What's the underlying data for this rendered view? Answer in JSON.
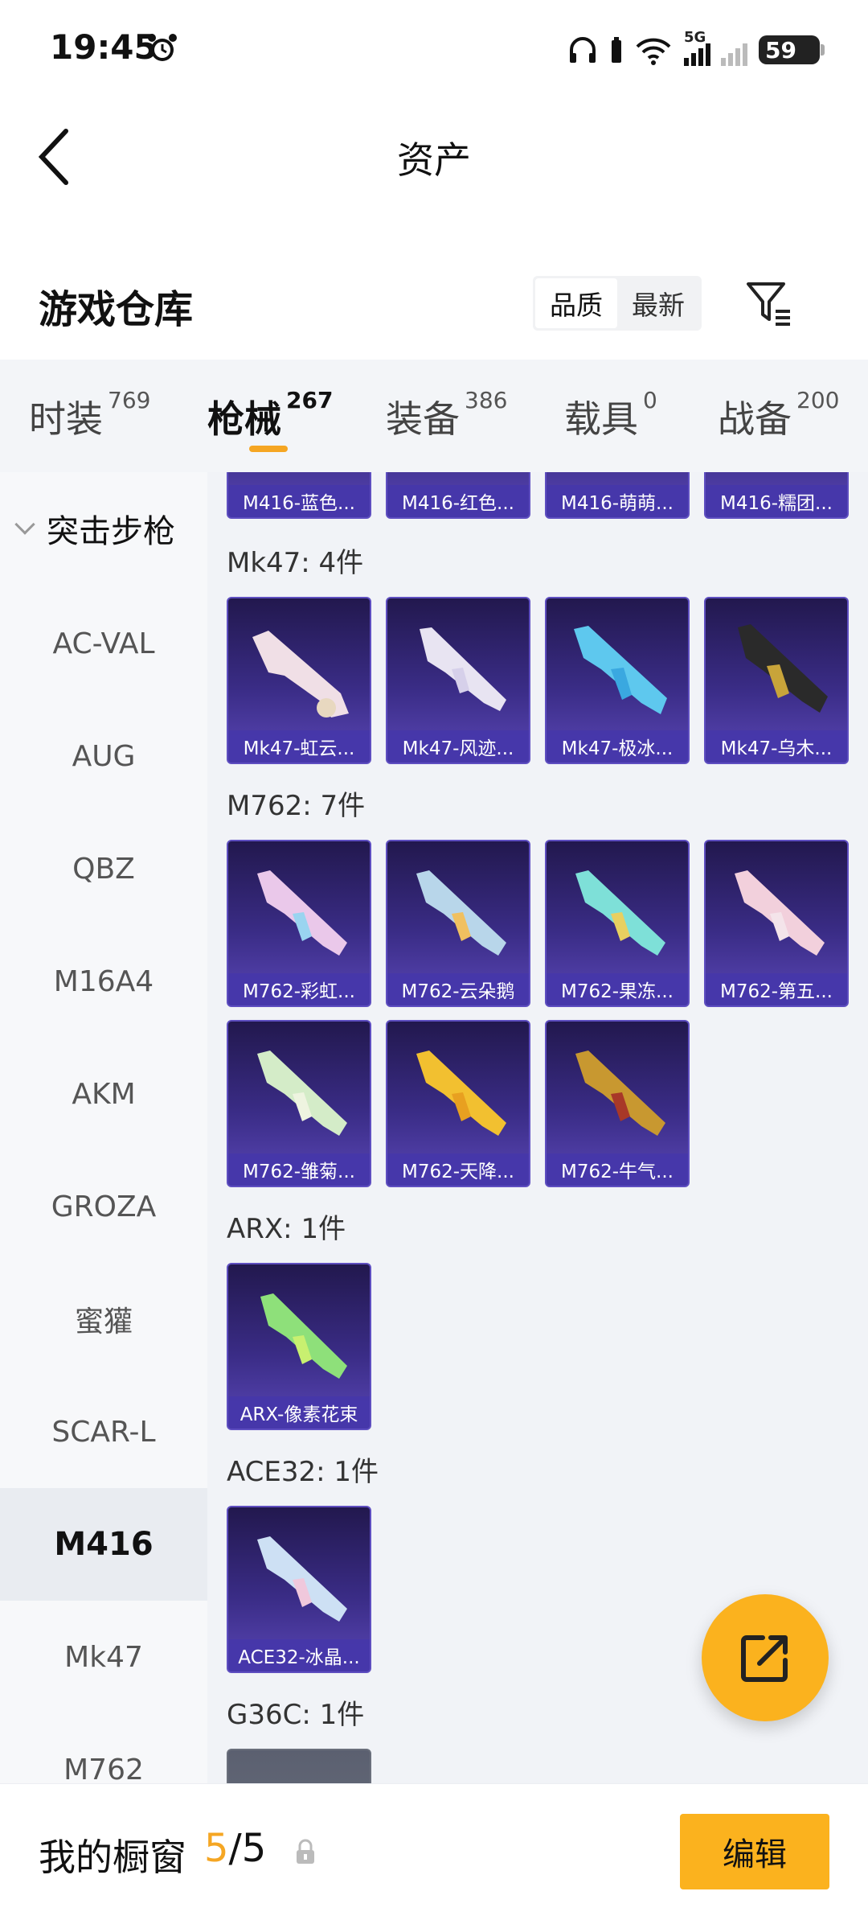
{
  "status_bar": {
    "time": "19:45",
    "battery": "59",
    "network": "5G",
    "icons": [
      "alarm-icon",
      "headphones-icon",
      "wifi-icon",
      "signal-icon",
      "battery-icon"
    ]
  },
  "header": {
    "title": "资产",
    "back_icon": "chevron-left-icon"
  },
  "section": {
    "title": "游戏仓库",
    "sort_options": [
      "品质",
      "最新"
    ],
    "sort_active": "品质",
    "filter_icon": "filter-icon"
  },
  "tabs": [
    {
      "label": "时装",
      "count": "769"
    },
    {
      "label": "枪械",
      "count": "267",
      "active": true
    },
    {
      "label": "装备",
      "count": "386"
    },
    {
      "label": "载具",
      "count": "0"
    },
    {
      "label": "战备",
      "count": "200"
    }
  ],
  "sidebar": {
    "category": "突击步枪",
    "items": [
      "AC-VAL",
      "AUG",
      "QBZ",
      "M16A4",
      "AKM",
      "GROZA",
      "蜜獾",
      "SCAR-L",
      "M416",
      "Mk47",
      "M762"
    ],
    "active": "M416"
  },
  "groups": {
    "m416": {
      "items": [
        "M416-蓝色...",
        "M416-红色...",
        "M416-萌萌...",
        "M416-糯团..."
      ]
    },
    "mk47": {
      "title": "Mk47: 4件",
      "items": [
        "Mk47-虹云...",
        "Mk47-风迹...",
        "Mk47-极冰...",
        "Mk47-乌木..."
      ]
    },
    "m762": {
      "title": "M762: 7件",
      "items": [
        "M762-彩虹...",
        "M762-云朵鹅",
        "M762-果冻...",
        "M762-第五...",
        "M762-雏菊...",
        "M762-天降...",
        "M762-牛气..."
      ]
    },
    "arx": {
      "title": "ARX: 1件",
      "items": [
        "ARX-像素花束"
      ]
    },
    "ace32": {
      "title": "ACE32: 1件",
      "items": [
        "ACE32-冰晶..."
      ]
    },
    "g36c": {
      "title": "G36C: 1件"
    }
  },
  "fab": {
    "icon": "share-icon"
  },
  "bottom": {
    "label": "我的橱窗",
    "current": "5",
    "separator": "/",
    "total": "5",
    "lock_icon": "lock-icon",
    "edit_label": "编辑"
  },
  "colors": {
    "accent": "#fbb21e",
    "card_bg": "#3a2c86",
    "card_label": "#4637aa"
  }
}
